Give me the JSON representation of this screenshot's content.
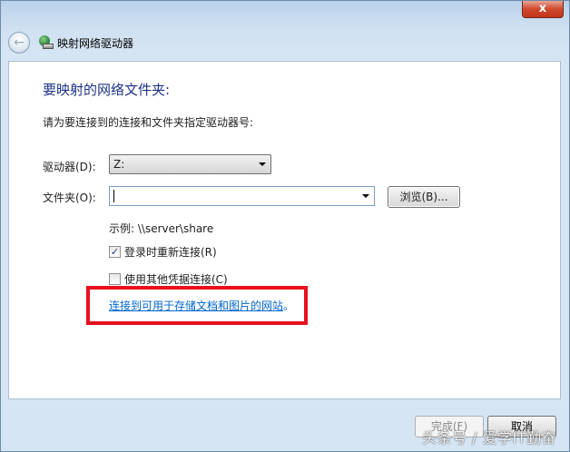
{
  "window": {
    "close_glyph": "x",
    "title": "映射网络驱动器"
  },
  "icons": {
    "back": "back-arrow-icon",
    "network_drive": "network-drive-icon",
    "dropdown": "chevron-down-icon",
    "close": "close-icon"
  },
  "colors": {
    "heading": "#1e3287",
    "link": "#0066cc",
    "highlight": "#e8101e",
    "close_button": "#c2341a"
  },
  "main": {
    "heading": "要映射的网络文件夹:",
    "instruction": "请为要连接到的连接和文件夹指定驱动器号:",
    "drive_label": "驱动器(D):",
    "drive_value": "Z:",
    "folder_label": "文件夹(O):",
    "folder_value": "",
    "browse_label": "浏览(B)...",
    "example": "示例: \\\\server\\share",
    "reconnect_label": "登录时重新连接(R)",
    "reconnect_checked": true,
    "reconnect_mark": "✓",
    "other_credentials_label": "使用其他凭据连接(C)",
    "other_credentials_checked": false,
    "link_text": "连接到可用于存储文档和图片的网站",
    "link_suffix": "。"
  },
  "footer": {
    "finish_label": "完成(F)",
    "cancel_label": "取消"
  },
  "watermark": "头条号 / 爱学IT勤奋"
}
